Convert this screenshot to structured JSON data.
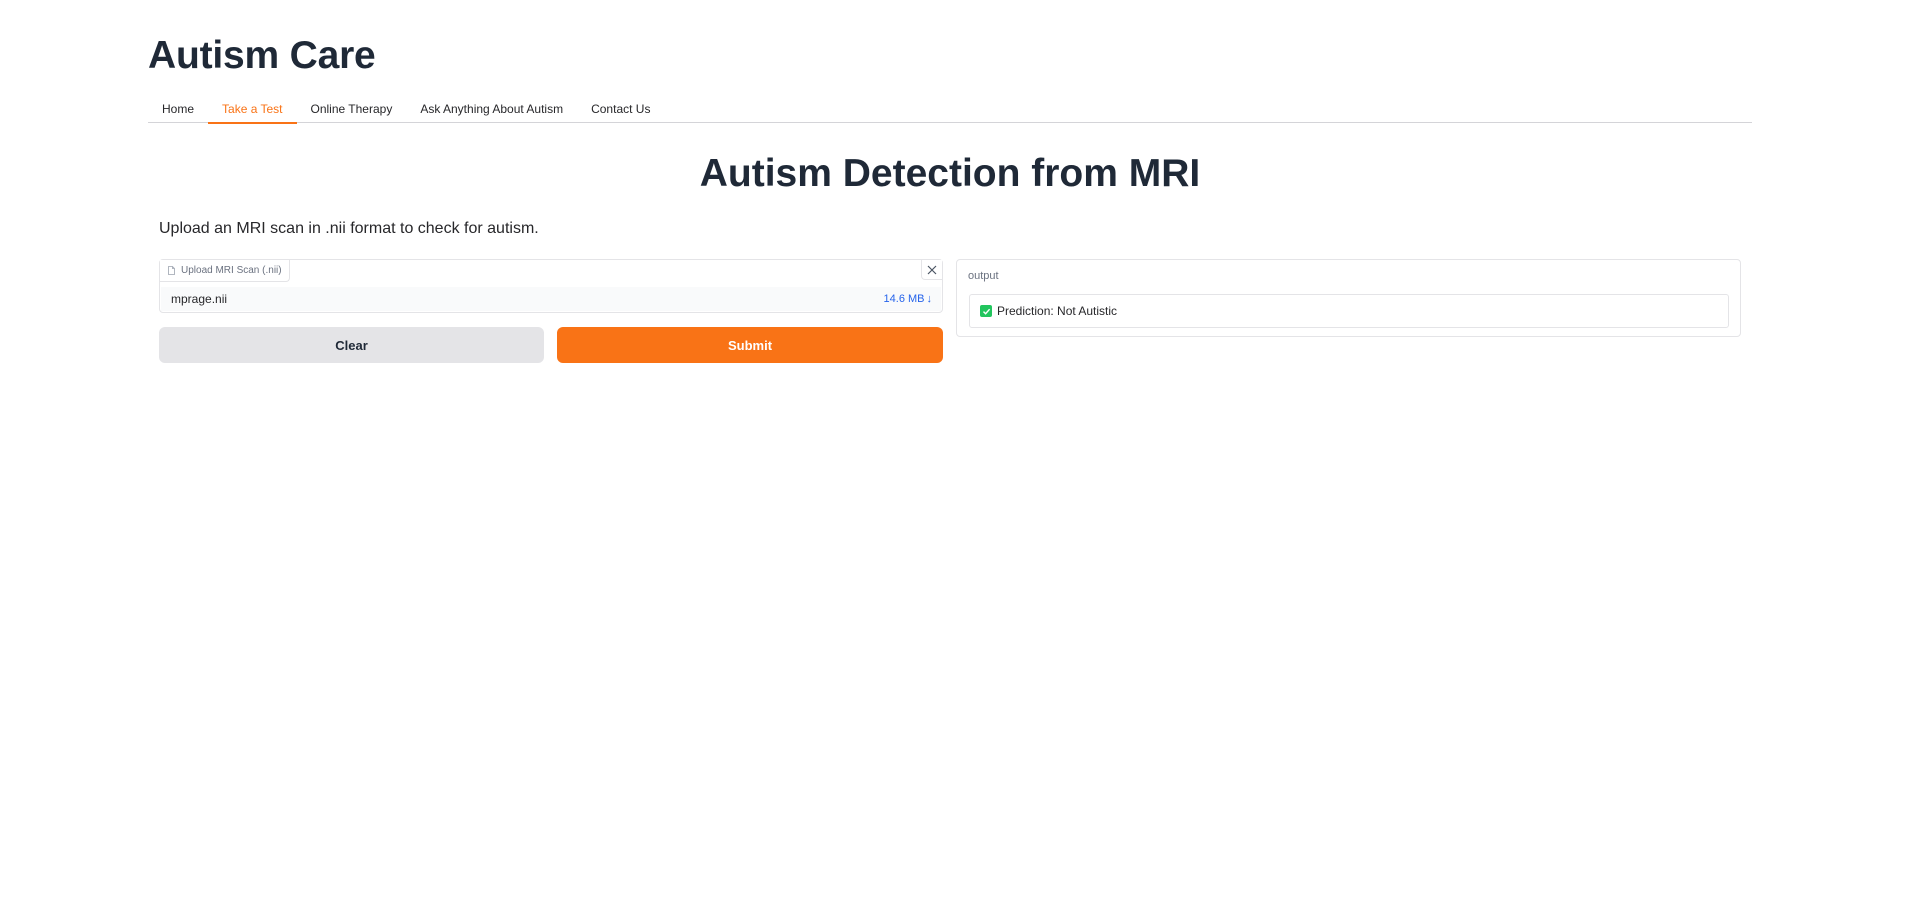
{
  "header": {
    "title": "Autism Care"
  },
  "tabs": [
    {
      "label": "Home",
      "active": false
    },
    {
      "label": "Take a Test",
      "active": true
    },
    {
      "label": "Online Therapy",
      "active": false
    },
    {
      "label": "Ask Anything About Autism",
      "active": false
    },
    {
      "label": "Contact Us",
      "active": false
    }
  ],
  "main": {
    "heading": "Autism Detection from MRI",
    "description": "Upload an MRI scan in .nii format to check for autism."
  },
  "upload": {
    "label": "Upload MRI Scan (.nii)",
    "file_name": "mprage.nii",
    "file_size": "14.6 MB",
    "file_size_arrow": "↓"
  },
  "buttons": {
    "clear": "Clear",
    "submit": "Submit"
  },
  "output": {
    "label": "output",
    "value": "Prediction: Not Autistic"
  },
  "colors": {
    "accent": "#f97316",
    "success": "#22c55e",
    "link": "#2563eb"
  }
}
